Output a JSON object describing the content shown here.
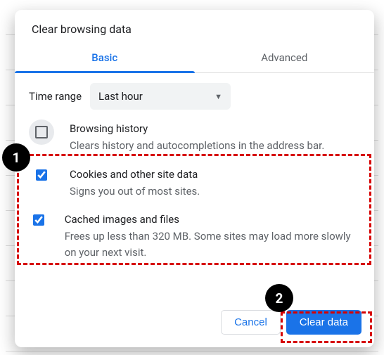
{
  "dialog": {
    "title": "Clear browsing data",
    "tabs": {
      "basic": "Basic",
      "advanced": "Advanced"
    },
    "range_label": "Time range",
    "range_value": "Last hour",
    "options": {
      "history": {
        "title": "Browsing history",
        "desc": "Clears history and autocompletions in the address bar."
      },
      "cookies": {
        "title": "Cookies and other site data",
        "desc": "Signs you out of most sites."
      },
      "cache": {
        "title": "Cached images and files",
        "desc": "Frees up less than 320 MB. Some sites may load more slowly on your next visit."
      }
    },
    "buttons": {
      "cancel": "Cancel",
      "clear": "Clear data"
    }
  },
  "annotations": {
    "n1": "1",
    "n2": "2"
  }
}
